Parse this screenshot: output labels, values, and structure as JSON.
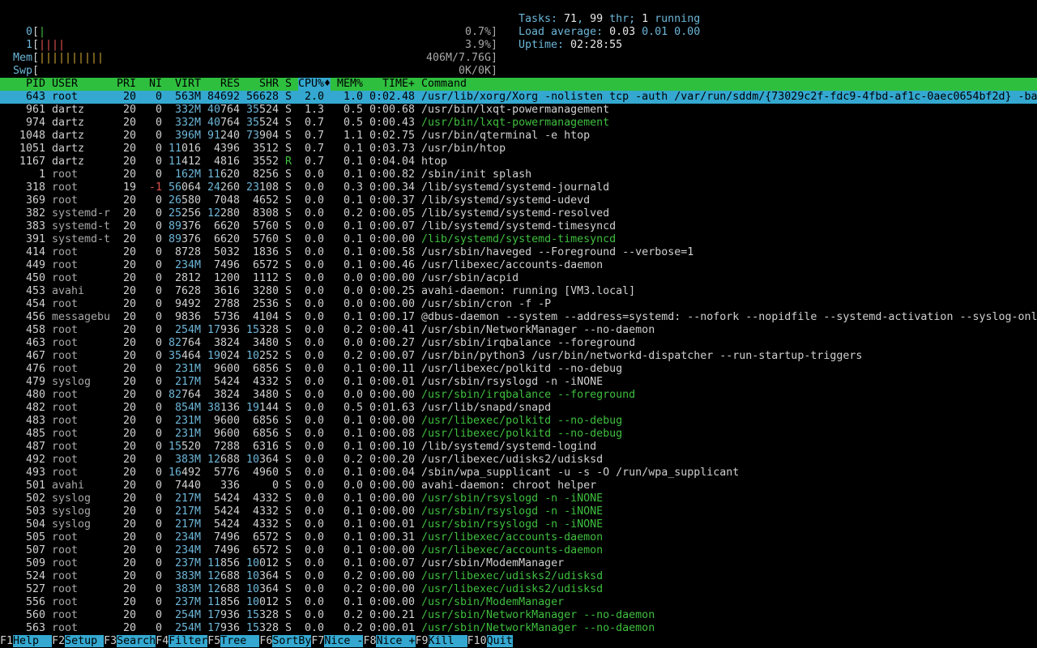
{
  "meters": {
    "cpu0": {
      "label": "0",
      "bar": "|",
      "value": "0.7%]"
    },
    "cpu1": {
      "label": "1",
      "bar": "||||",
      "value": "3.9%]"
    },
    "mem": {
      "label": "Mem",
      "bar": "||||||||||",
      "value": "406M/7.76G]"
    },
    "swp": {
      "label": "Swp",
      "bar": "",
      "value": "0K/0K]"
    }
  },
  "stats": {
    "tasks_label": "Tasks: ",
    "tasks": "71",
    "thr_sep": ", ",
    "thr": "99",
    "thr_label": " thr; ",
    "running": "1",
    "running_label": " running",
    "load_label": "Load average: ",
    "load1": "0.03",
    "load5": "0.01",
    "load15": "0.00",
    "uptime_label": "Uptime: ",
    "uptime": "02:28:55"
  },
  "columns": {
    "pid": "PID",
    "user": "USER",
    "pri": "PRI",
    "ni": "NI",
    "virt": "VIRT",
    "res": "RES",
    "shr": "SHR",
    "s": "S",
    "cpu": "CPU%♦",
    "mem": "MEM%",
    "time": "TIME+",
    "cmd": "Command"
  },
  "processes": [
    {
      "pid": "643",
      "user": "root",
      "pri": "20",
      "ni": "0",
      "virt": "563M",
      "res": "84692",
      "shr": "56628",
      "s": "S",
      "cpu": "2.0",
      "mem": "1.0",
      "time": "0:02.48",
      "cmd": "/usr/lib/xorg/Xorg -nolisten tcp -auth /var/run/sddm/{73029c2f-fdc9-4fbd-af1c-0aec0654bf2d} -ba",
      "selected": true
    },
    {
      "pid": "961",
      "user": "dartz",
      "pri": "20",
      "ni": "0",
      "virt": "332M",
      "res": "40764",
      "shr": "35524",
      "s": "S",
      "cpu": "1.3",
      "mem": "0.5",
      "time": "0:00.68",
      "cmd": "/usr/bin/lxqt-powermanagement"
    },
    {
      "pid": "974",
      "user": "dartz",
      "pri": "20",
      "ni": "0",
      "virt": "332M",
      "res": "40764",
      "shr": "35524",
      "s": "S",
      "cpu": "0.7",
      "mem": "0.5",
      "time": "0:00.43",
      "cmd": "/usr/bin/lxqt-powermanagement",
      "thread": true
    },
    {
      "pid": "1048",
      "user": "dartz",
      "pri": "20",
      "ni": "0",
      "virt": "396M",
      "res": "91240",
      "shr": "73904",
      "s": "S",
      "cpu": "0.7",
      "mem": "1.1",
      "time": "0:02.75",
      "cmd": "/usr/bin/qterminal -e htop"
    },
    {
      "pid": "1051",
      "user": "dartz",
      "pri": "20",
      "ni": "0",
      "virt": "11016",
      "res": "4396",
      "shr": "3512",
      "s": "S",
      "cpu": "0.7",
      "mem": "0.1",
      "time": "0:03.73",
      "cmd": "/usr/bin/htop"
    },
    {
      "pid": "1167",
      "user": "dartz",
      "pri": "20",
      "ni": "0",
      "virt": "11412",
      "res": "4816",
      "shr": "3552",
      "s": "R",
      "cpu": "0.7",
      "mem": "0.1",
      "time": "0:04.04",
      "cmd": "htop"
    },
    {
      "pid": "1",
      "user": "root",
      "pri": "20",
      "ni": "0",
      "virt": "162M",
      "res": "11620",
      "shr": "8256",
      "s": "S",
      "cpu": "0.0",
      "mem": "0.1",
      "time": "0:00.82",
      "cmd": "/sbin/init splash"
    },
    {
      "pid": "318",
      "user": "root",
      "pri": "19",
      "ni": "-1",
      "virt": "56064",
      "res": "24260",
      "shr": "23108",
      "s": "S",
      "cpu": "0.0",
      "mem": "0.3",
      "time": "0:00.34",
      "cmd": "/lib/systemd/systemd-journald"
    },
    {
      "pid": "369",
      "user": "root",
      "pri": "20",
      "ni": "0",
      "virt": "26580",
      "res": "7048",
      "shr": "4652",
      "s": "S",
      "cpu": "0.0",
      "mem": "0.1",
      "time": "0:00.37",
      "cmd": "/lib/systemd/systemd-udevd"
    },
    {
      "pid": "382",
      "user": "systemd-r",
      "pri": "20",
      "ni": "0",
      "virt": "25256",
      "res": "12280",
      "shr": "8308",
      "s": "S",
      "cpu": "0.0",
      "mem": "0.2",
      "time": "0:00.05",
      "cmd": "/lib/systemd/systemd-resolved"
    },
    {
      "pid": "383",
      "user": "systemd-t",
      "pri": "20",
      "ni": "0",
      "virt": "89376",
      "res": "6620",
      "shr": "5760",
      "s": "S",
      "cpu": "0.0",
      "mem": "0.1",
      "time": "0:00.07",
      "cmd": "/lib/systemd/systemd-timesyncd"
    },
    {
      "pid": "391",
      "user": "systemd-t",
      "pri": "20",
      "ni": "0",
      "virt": "89376",
      "res": "6620",
      "shr": "5760",
      "s": "S",
      "cpu": "0.0",
      "mem": "0.1",
      "time": "0:00.00",
      "cmd": "/lib/systemd/systemd-timesyncd",
      "thread": true
    },
    {
      "pid": "414",
      "user": "root",
      "pri": "20",
      "ni": "0",
      "virt": "8728",
      "res": "5032",
      "shr": "1836",
      "s": "S",
      "cpu": "0.0",
      "mem": "0.1",
      "time": "0:00.58",
      "cmd": "/usr/sbin/haveged --Foreground --verbose=1"
    },
    {
      "pid": "449",
      "user": "root",
      "pri": "20",
      "ni": "0",
      "virt": "234M",
      "res": "7496",
      "shr": "6572",
      "s": "S",
      "cpu": "0.0",
      "mem": "0.1",
      "time": "0:00.46",
      "cmd": "/usr/libexec/accounts-daemon"
    },
    {
      "pid": "450",
      "user": "root",
      "pri": "20",
      "ni": "0",
      "virt": "2812",
      "res": "1200",
      "shr": "1112",
      "s": "S",
      "cpu": "0.0",
      "mem": "0.0",
      "time": "0:00.00",
      "cmd": "/usr/sbin/acpid"
    },
    {
      "pid": "453",
      "user": "avahi",
      "pri": "20",
      "ni": "0",
      "virt": "7628",
      "res": "3616",
      "shr": "3280",
      "s": "S",
      "cpu": "0.0",
      "mem": "0.0",
      "time": "0:00.25",
      "cmd": "avahi-daemon: running [VM3.local]"
    },
    {
      "pid": "454",
      "user": "root",
      "pri": "20",
      "ni": "0",
      "virt": "9492",
      "res": "2788",
      "shr": "2536",
      "s": "S",
      "cpu": "0.0",
      "mem": "0.0",
      "time": "0:00.00",
      "cmd": "/usr/sbin/cron -f -P"
    },
    {
      "pid": "456",
      "user": "messagebu",
      "pri": "20",
      "ni": "0",
      "virt": "9836",
      "res": "5736",
      "shr": "4104",
      "s": "S",
      "cpu": "0.0",
      "mem": "0.1",
      "time": "0:00.17",
      "cmd": "@dbus-daemon --system --address=systemd: --nofork --nopidfile --systemd-activation --syslog-onl"
    },
    {
      "pid": "458",
      "user": "root",
      "pri": "20",
      "ni": "0",
      "virt": "254M",
      "res": "17936",
      "shr": "15328",
      "s": "S",
      "cpu": "0.0",
      "mem": "0.2",
      "time": "0:00.41",
      "cmd": "/usr/sbin/NetworkManager --no-daemon"
    },
    {
      "pid": "463",
      "user": "root",
      "pri": "20",
      "ni": "0",
      "virt": "82764",
      "res": "3824",
      "shr": "3480",
      "s": "S",
      "cpu": "0.0",
      "mem": "0.0",
      "time": "0:00.27",
      "cmd": "/usr/sbin/irqbalance --foreground"
    },
    {
      "pid": "467",
      "user": "root",
      "pri": "20",
      "ni": "0",
      "virt": "35464",
      "res": "19024",
      "shr": "10252",
      "s": "S",
      "cpu": "0.0",
      "mem": "0.2",
      "time": "0:00.07",
      "cmd": "/usr/bin/python3 /usr/bin/networkd-dispatcher --run-startup-triggers"
    },
    {
      "pid": "476",
      "user": "root",
      "pri": "20",
      "ni": "0",
      "virt": "231M",
      "res": "9600",
      "shr": "6856",
      "s": "S",
      "cpu": "0.0",
      "mem": "0.1",
      "time": "0:00.11",
      "cmd": "/usr/libexec/polkitd --no-debug"
    },
    {
      "pid": "479",
      "user": "syslog",
      "pri": "20",
      "ni": "0",
      "virt": "217M",
      "res": "5424",
      "shr": "4332",
      "s": "S",
      "cpu": "0.0",
      "mem": "0.1",
      "time": "0:00.01",
      "cmd": "/usr/sbin/rsyslogd -n -iNONE"
    },
    {
      "pid": "480",
      "user": "root",
      "pri": "20",
      "ni": "0",
      "virt": "82764",
      "res": "3824",
      "shr": "3480",
      "s": "S",
      "cpu": "0.0",
      "mem": "0.0",
      "time": "0:00.00",
      "cmd": "/usr/sbin/irqbalance --foreground",
      "thread": true
    },
    {
      "pid": "482",
      "user": "root",
      "pri": "20",
      "ni": "0",
      "virt": "854M",
      "res": "38136",
      "shr": "19144",
      "s": "S",
      "cpu": "0.0",
      "mem": "0.5",
      "time": "0:01.63",
      "cmd": "/usr/lib/snapd/snapd"
    },
    {
      "pid": "483",
      "user": "root",
      "pri": "20",
      "ni": "0",
      "virt": "231M",
      "res": "9600",
      "shr": "6856",
      "s": "S",
      "cpu": "0.0",
      "mem": "0.1",
      "time": "0:00.00",
      "cmd": "/usr/libexec/polkitd --no-debug",
      "thread": true
    },
    {
      "pid": "485",
      "user": "root",
      "pri": "20",
      "ni": "0",
      "virt": "231M",
      "res": "9600",
      "shr": "6856",
      "s": "S",
      "cpu": "0.0",
      "mem": "0.1",
      "time": "0:00.08",
      "cmd": "/usr/libexec/polkitd --no-debug",
      "thread": true
    },
    {
      "pid": "487",
      "user": "root",
      "pri": "20",
      "ni": "0",
      "virt": "15520",
      "res": "7288",
      "shr": "6316",
      "s": "S",
      "cpu": "0.0",
      "mem": "0.1",
      "time": "0:00.10",
      "cmd": "/lib/systemd/systemd-logind"
    },
    {
      "pid": "492",
      "user": "root",
      "pri": "20",
      "ni": "0",
      "virt": "383M",
      "res": "12688",
      "shr": "10364",
      "s": "S",
      "cpu": "0.0",
      "mem": "0.2",
      "time": "0:00.20",
      "cmd": "/usr/libexec/udisks2/udisksd"
    },
    {
      "pid": "493",
      "user": "root",
      "pri": "20",
      "ni": "0",
      "virt": "16492",
      "res": "5776",
      "shr": "4960",
      "s": "S",
      "cpu": "0.0",
      "mem": "0.1",
      "time": "0:00.04",
      "cmd": "/sbin/wpa_supplicant -u -s -O /run/wpa_supplicant"
    },
    {
      "pid": "501",
      "user": "avahi",
      "pri": "20",
      "ni": "0",
      "virt": "7440",
      "res": "336",
      "shr": "0",
      "s": "S",
      "cpu": "0.0",
      "mem": "0.0",
      "time": "0:00.00",
      "cmd": "avahi-daemon: chroot helper"
    },
    {
      "pid": "502",
      "user": "syslog",
      "pri": "20",
      "ni": "0",
      "virt": "217M",
      "res": "5424",
      "shr": "4332",
      "s": "S",
      "cpu": "0.0",
      "mem": "0.1",
      "time": "0:00.00",
      "cmd": "/usr/sbin/rsyslogd -n -iNONE",
      "thread": true
    },
    {
      "pid": "503",
      "user": "syslog",
      "pri": "20",
      "ni": "0",
      "virt": "217M",
      "res": "5424",
      "shr": "4332",
      "s": "S",
      "cpu": "0.0",
      "mem": "0.1",
      "time": "0:00.00",
      "cmd": "/usr/sbin/rsyslogd -n -iNONE",
      "thread": true
    },
    {
      "pid": "504",
      "user": "syslog",
      "pri": "20",
      "ni": "0",
      "virt": "217M",
      "res": "5424",
      "shr": "4332",
      "s": "S",
      "cpu": "0.0",
      "mem": "0.1",
      "time": "0:00.01",
      "cmd": "/usr/sbin/rsyslogd -n -iNONE",
      "thread": true
    },
    {
      "pid": "505",
      "user": "root",
      "pri": "20",
      "ni": "0",
      "virt": "234M",
      "res": "7496",
      "shr": "6572",
      "s": "S",
      "cpu": "0.0",
      "mem": "0.1",
      "time": "0:00.31",
      "cmd": "/usr/libexec/accounts-daemon",
      "thread": true
    },
    {
      "pid": "507",
      "user": "root",
      "pri": "20",
      "ni": "0",
      "virt": "234M",
      "res": "7496",
      "shr": "6572",
      "s": "S",
      "cpu": "0.0",
      "mem": "0.1",
      "time": "0:00.00",
      "cmd": "/usr/libexec/accounts-daemon",
      "thread": true
    },
    {
      "pid": "509",
      "user": "root",
      "pri": "20",
      "ni": "0",
      "virt": "237M",
      "res": "11856",
      "shr": "10012",
      "s": "S",
      "cpu": "0.0",
      "mem": "0.1",
      "time": "0:00.07",
      "cmd": "/usr/sbin/ModemManager"
    },
    {
      "pid": "524",
      "user": "root",
      "pri": "20",
      "ni": "0",
      "virt": "383M",
      "res": "12688",
      "shr": "10364",
      "s": "S",
      "cpu": "0.0",
      "mem": "0.2",
      "time": "0:00.00",
      "cmd": "/usr/libexec/udisks2/udisksd",
      "thread": true
    },
    {
      "pid": "527",
      "user": "root",
      "pri": "20",
      "ni": "0",
      "virt": "383M",
      "res": "12688",
      "shr": "10364",
      "s": "S",
      "cpu": "0.0",
      "mem": "0.2",
      "time": "0:00.00",
      "cmd": "/usr/libexec/udisks2/udisksd",
      "thread": true
    },
    {
      "pid": "556",
      "user": "root",
      "pri": "20",
      "ni": "0",
      "virt": "237M",
      "res": "11856",
      "shr": "10012",
      "s": "S",
      "cpu": "0.0",
      "mem": "0.1",
      "time": "0:00.00",
      "cmd": "/usr/sbin/ModemManager",
      "thread": true
    },
    {
      "pid": "560",
      "user": "root",
      "pri": "20",
      "ni": "0",
      "virt": "254M",
      "res": "17936",
      "shr": "15328",
      "s": "S",
      "cpu": "0.0",
      "mem": "0.2",
      "time": "0:00.21",
      "cmd": "/usr/sbin/NetworkManager --no-daemon",
      "thread": true
    },
    {
      "pid": "563",
      "user": "root",
      "pri": "20",
      "ni": "0",
      "virt": "254M",
      "res": "17936",
      "shr": "15328",
      "s": "S",
      "cpu": "0.0",
      "mem": "0.2",
      "time": "0:00.01",
      "cmd": "/usr/sbin/NetworkManager --no-daemon",
      "thread": true
    }
  ],
  "footer": [
    {
      "key": "F1",
      "label": "Help  "
    },
    {
      "key": "F2",
      "label": "Setup "
    },
    {
      "key": "F3",
      "label": "Search"
    },
    {
      "key": "F4",
      "label": "Filter"
    },
    {
      "key": "F5",
      "label": "Tree  "
    },
    {
      "key": "F6",
      "label": "SortBy"
    },
    {
      "key": "F7",
      "label": "Nice -"
    },
    {
      "key": "F8",
      "label": "Nice +"
    },
    {
      "key": "F9",
      "label": "Kill  "
    },
    {
      "key": "F10",
      "label": "Quit"
    }
  ],
  "colors": {
    "header_bg": "#2fbf3f",
    "selection_bg": "#34a8d0",
    "thread_fg": "#3fbf3f",
    "highlight_fg": "#6cb6d8"
  }
}
